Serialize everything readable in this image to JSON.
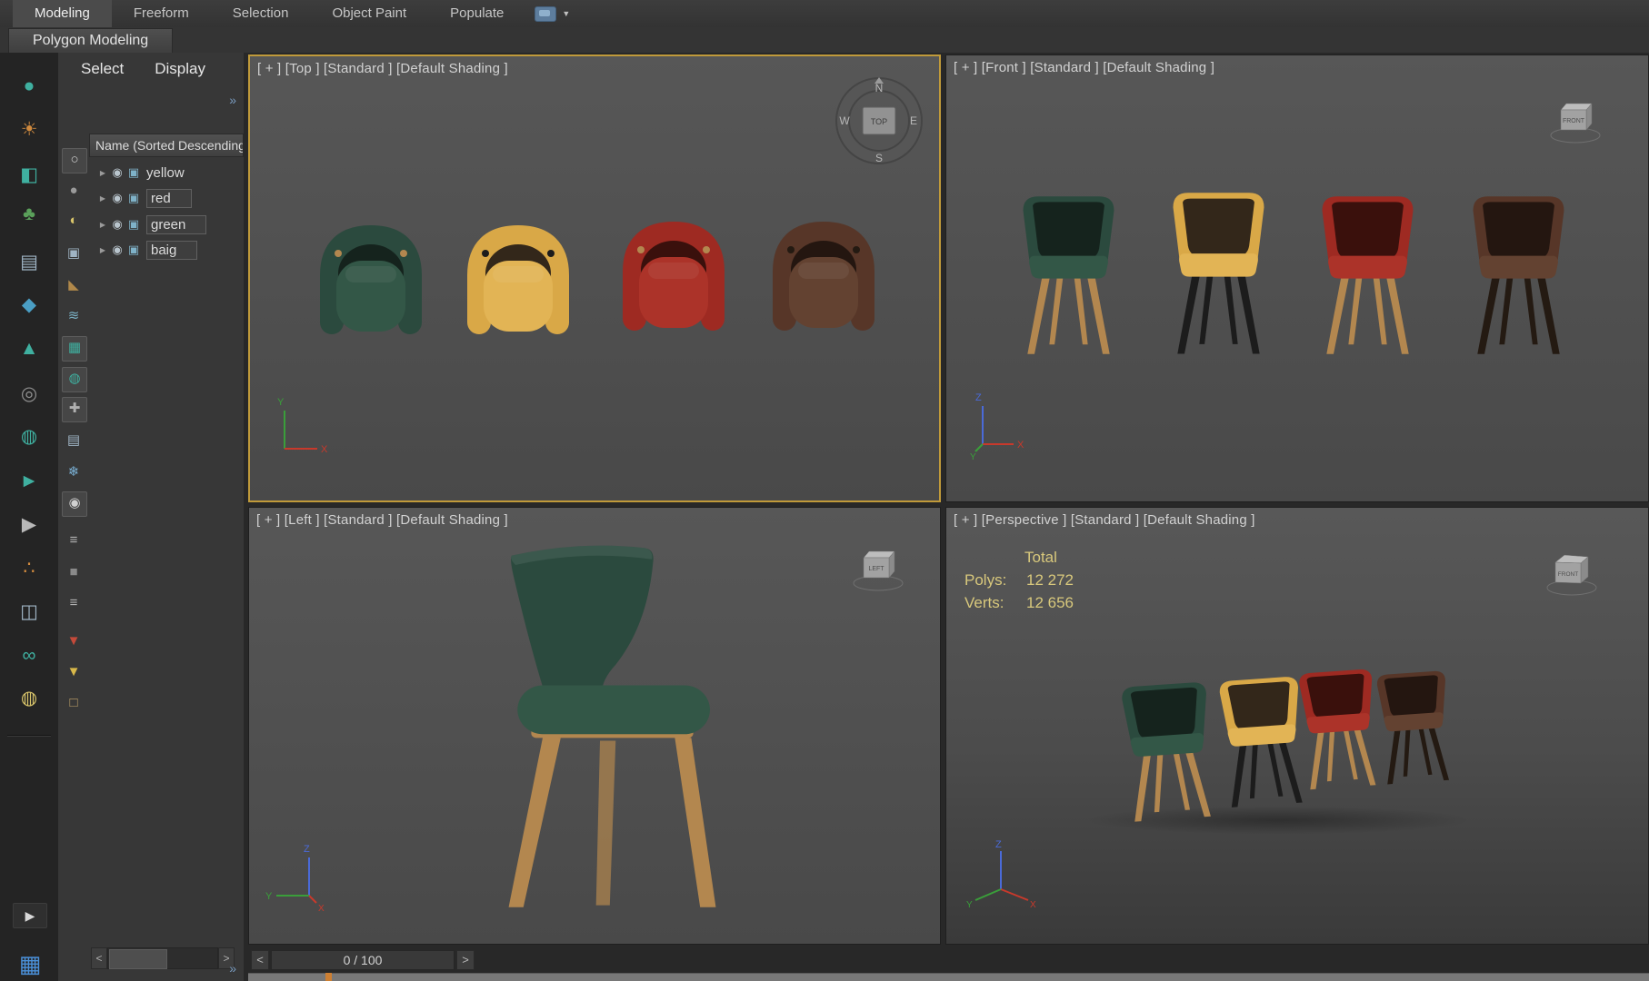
{
  "ribbon": {
    "tabs": [
      {
        "label": "Modeling",
        "active": true
      },
      {
        "label": "Freeform",
        "active": false
      },
      {
        "label": "Selection",
        "active": false
      },
      {
        "label": "Object Paint",
        "active": false
      },
      {
        "label": "Populate",
        "active": false
      }
    ],
    "subtab": "Polygon Modeling",
    "caret": "▼"
  },
  "explorer": {
    "menu": {
      "select": "Select",
      "display": "Display"
    },
    "chevron": "»",
    "header": "Name (Sorted Descending)",
    "items": [
      "yellow",
      "red",
      "green",
      "baig"
    ],
    "row_icons": {
      "expand": "▶",
      "eye": "◉",
      "type": "▣"
    },
    "scroll": {
      "left": "<",
      "right": ">"
    }
  },
  "left_toolbar": {
    "icons": [
      {
        "name": "pointer-ball-icon",
        "glyph": "●",
        "color": "#3fb0a0"
      },
      {
        "name": "sun-gizmo-icon",
        "glyph": "☀",
        "color": "#d08a3e"
      },
      {
        "name": "camera-icon",
        "glyph": "◧",
        "color": "#3fb0a0"
      },
      {
        "name": "tree-icon",
        "glyph": "♣",
        "color": "#5aa05a"
      },
      {
        "name": "panel-list-icon",
        "glyph": "▤",
        "color": "#9fb4c4"
      },
      {
        "name": "ink-drop-icon",
        "glyph": "◆",
        "color": "#4a9ec4"
      },
      {
        "name": "cone-icon",
        "glyph": "▲",
        "color": "#3fb0a0"
      },
      {
        "name": "torus-icon",
        "glyph": "◎",
        "color": "#8f8f8f"
      },
      {
        "name": "sphere-project-icon",
        "glyph": "◍",
        "color": "#3fb0a0"
      },
      {
        "name": "move-tool-icon",
        "glyph": "►",
        "color": "#3fb0a0"
      },
      {
        "name": "media-play-icon",
        "glyph": "▶",
        "color": "#b8b8b8"
      },
      {
        "name": "populate-people-icon",
        "glyph": "∴",
        "color": "#d08a3e"
      },
      {
        "name": "split-window-icon",
        "glyph": "◫",
        "color": "#9fb4c4"
      },
      {
        "name": "goggles-icon",
        "glyph": "∞",
        "color": "#3fb0a0"
      },
      {
        "name": "bulb-icon",
        "glyph": "◍",
        "color": "#d8c46a"
      }
    ],
    "bottom": [
      {
        "name": "expand-play-button",
        "glyph": "▶",
        "color": "#d8d8d8"
      },
      {
        "name": "ui-palette-icon",
        "glyph": "▦",
        "color": "#4a90d9"
      }
    ]
  },
  "filter_toolbar": {
    "icons": [
      {
        "name": "filter-circle-icon",
        "glyph": "○",
        "color": "#d0d0d0",
        "active": true
      },
      {
        "name": "filter-sphere-icon",
        "glyph": "●",
        "color": "#9a9a9a",
        "active": false
      },
      {
        "name": "filter-light-icon",
        "glyph": "◐",
        "color": "#d8c46a",
        "active": false
      },
      {
        "name": "filter-camera-icon",
        "glyph": "▣",
        "color": "#9fb4c4",
        "active": false
      },
      {
        "name": "filter-ruler-icon",
        "glyph": "◣",
        "color": "#b0884a",
        "active": false
      },
      {
        "name": "filter-waves-icon",
        "glyph": "≋",
        "color": "#7ab0c4",
        "active": false
      },
      {
        "name": "filter-geometry-icon",
        "glyph": "▦",
        "color": "#3fb0a0",
        "active": true
      },
      {
        "name": "filter-globe-icon",
        "glyph": "◍",
        "color": "#3fb0a0",
        "active": true
      },
      {
        "name": "filter-wrench-icon",
        "glyph": "✚",
        "color": "#b0b0b0",
        "active": true
      },
      {
        "name": "filter-panel-icon",
        "glyph": "▤",
        "color": "#9fb4c4",
        "active": false
      },
      {
        "name": "filter-snowflake-icon",
        "glyph": "❄",
        "color": "#7ab0d4",
        "active": false
      },
      {
        "name": "filter-eye-icon",
        "glyph": "◉",
        "color": "#d0d0d0",
        "active": true
      },
      {
        "name": "filter-list-icon",
        "glyph": "≡",
        "color": "#b0b0b0",
        "active": false
      },
      {
        "name": "filter-square-icon",
        "glyph": "■",
        "color": "#8a8a8a",
        "active": false
      },
      {
        "name": "filter-notes-icon",
        "glyph": "≡",
        "color": "#b0b0b0",
        "active": false
      },
      {
        "name": "filter-pin-icon",
        "glyph": "▼",
        "color": "#c44a3a",
        "active": false
      },
      {
        "name": "filter-funnel-icon",
        "glyph": "▼",
        "color": "#d8b84a",
        "active": false
      },
      {
        "name": "filter-crate-icon",
        "glyph": "□",
        "color": "#c4a46a",
        "active": false
      }
    ]
  },
  "viewports": {
    "top": {
      "label": "[ + ] [Top ] [Standard ] [Default Shading ]"
    },
    "front": {
      "label": "[ + ] [Front ] [Standard ] [Default Shading ]"
    },
    "left": {
      "label": "[ + ] [Left ] [Standard ] [Default Shading ]"
    },
    "perspective": {
      "label": "[ + ] [Perspective ] [Standard ] [Default Shading ]"
    }
  },
  "stats": {
    "total_label": "Total",
    "polys_label": "Polys:",
    "polys_value": "12 272",
    "verts_label": "Verts:",
    "verts_value": "12 656"
  },
  "viewcube": {
    "n": "N",
    "e": "E",
    "s": "S",
    "w": "W",
    "top": "TOP",
    "front": "FRONT",
    "left": "LEFT"
  },
  "axes": {
    "x": "X",
    "y": "Y",
    "z": "Z"
  },
  "axis_colors": {
    "x": "#c8392b",
    "y": "#3a9e3a",
    "z": "#4a6ad8"
  },
  "timeline": {
    "prev": "<",
    "value": "0 / 100",
    "next": ">"
  },
  "chairs": {
    "green": {
      "body": "#2b4a3e",
      "seat": "#335747",
      "inner": "#15231d",
      "legs": "#b3874f"
    },
    "yellow": {
      "body": "#d9a847",
      "seat": "#e2b455",
      "inner": "#33271a",
      "legs": "#1c1c1c"
    },
    "red": {
      "body": "#9e2a22",
      "seat": "#ac3329",
      "inner": "#3a100c",
      "legs": "#b3874f"
    },
    "brown": {
      "body": "#573628",
      "seat": "#634231",
      "inner": "#241610",
      "legs": "#241a12"
    }
  }
}
